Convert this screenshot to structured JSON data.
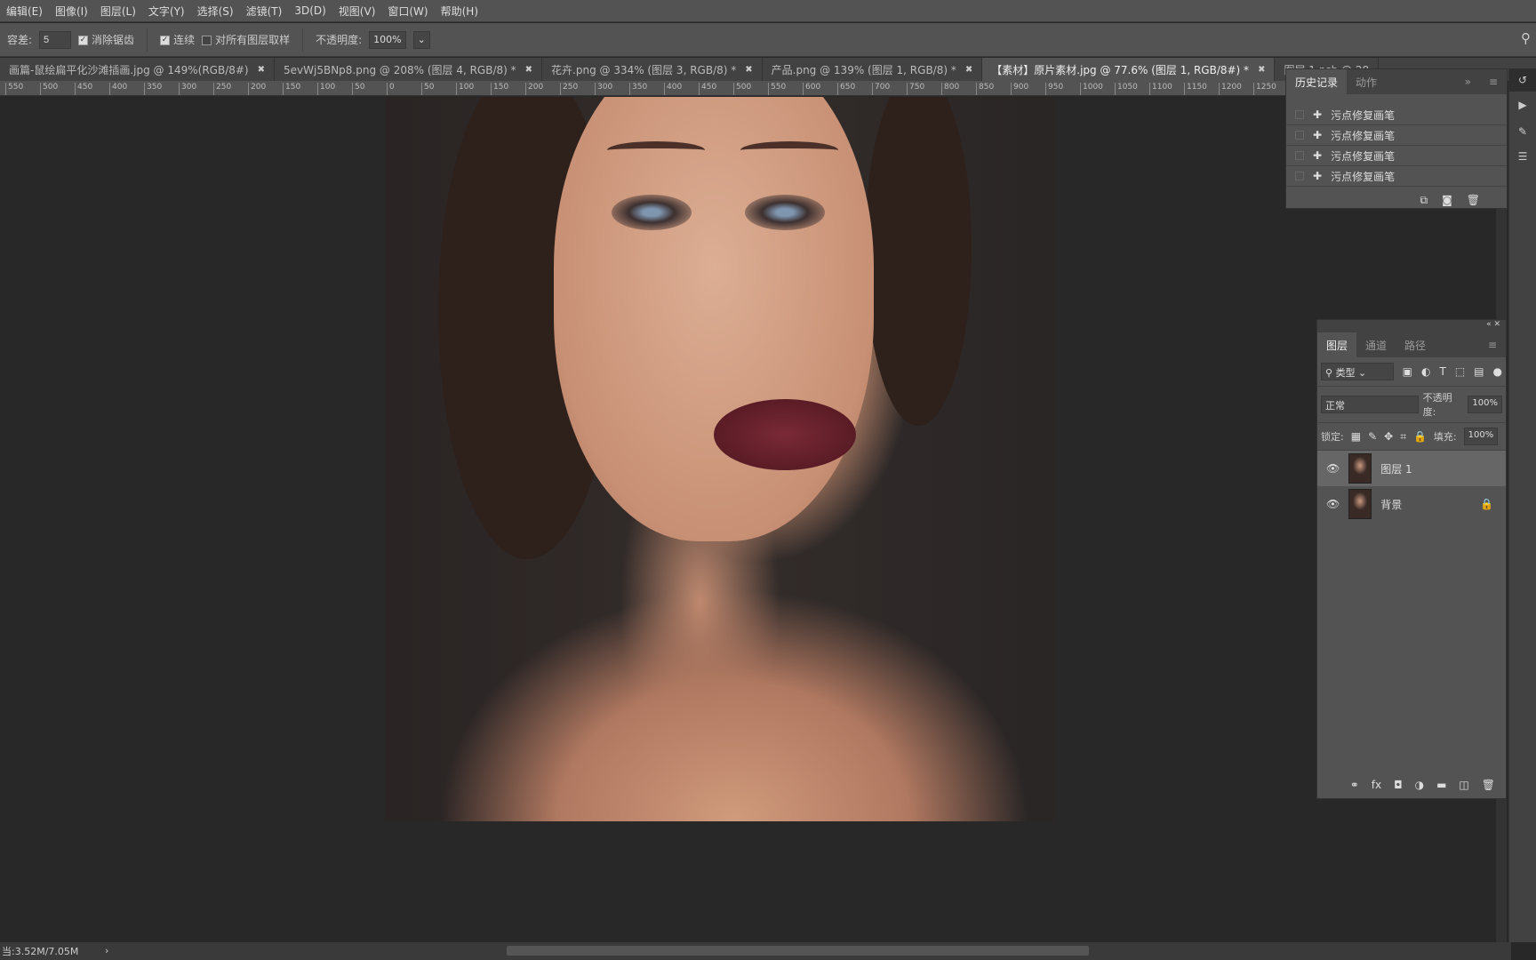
{
  "menu": [
    "编辑(E)",
    "图像(I)",
    "图层(L)",
    "文字(Y)",
    "选择(S)",
    "滤镜(T)",
    "3D(D)",
    "视图(V)",
    "窗口(W)",
    "帮助(H)"
  ],
  "options": {
    "tolerance_label": "容差:",
    "tolerance_value": "5",
    "antialias_label": "消除锯齿",
    "antialias_checked": true,
    "contiguous_label": "连续",
    "contiguous_checked": true,
    "sample_all_label": "对所有图层取样",
    "sample_all_checked": false,
    "opacity_label": "不透明度:",
    "opacity_value": "100%"
  },
  "tabs": [
    {
      "label": "画篇-鼠绘扁平化沙滩插画.jpg @ 149%(RGB/8#)",
      "active": false
    },
    {
      "label": "5evWj5BNp8.png @ 208% (图层 4, RGB/8) *",
      "active": false
    },
    {
      "label": "花卉.png @ 334% (图层 3, RGB/8) *",
      "active": false
    },
    {
      "label": "产品.png @ 139% (图层 1, RGB/8) *",
      "active": false
    },
    {
      "label": "【素材】原片素材.jpg @ 77.6% (图层 1, RGB/8#) *",
      "active": true
    },
    {
      "label": "图层 1.psb @ 28",
      "active": false
    }
  ],
  "ruler": [
    "550",
    "500",
    "450",
    "400",
    "350",
    "300",
    "250",
    "200",
    "150",
    "100",
    "50",
    "0",
    "50",
    "100",
    "150",
    "200",
    "250",
    "300",
    "350",
    "400",
    "450",
    "500",
    "550",
    "600",
    "650",
    "700",
    "750",
    "800",
    "850",
    "900",
    "950",
    "1000",
    "1050",
    "1100",
    "1150",
    "1200",
    "1250"
  ],
  "history": {
    "tabs": [
      "历史记录",
      "动作"
    ],
    "items": [
      "污点修复画笔",
      "污点修复画笔",
      "污点修复画笔",
      "污点修复画笔"
    ]
  },
  "layers": {
    "tabs": [
      "图层",
      "通道",
      "路径"
    ],
    "filter": "类型",
    "blend_mode": "正常",
    "opacity_label": "不透明度:",
    "opacity": "100%",
    "lock_label": "锁定:",
    "fill_label": "填充:",
    "fill": "100%",
    "items": [
      {
        "name": "图层 1",
        "selected": true,
        "locked": false
      },
      {
        "name": "背景",
        "selected": false,
        "locked": true
      }
    ]
  },
  "status": "当:3.52M/7.05M"
}
